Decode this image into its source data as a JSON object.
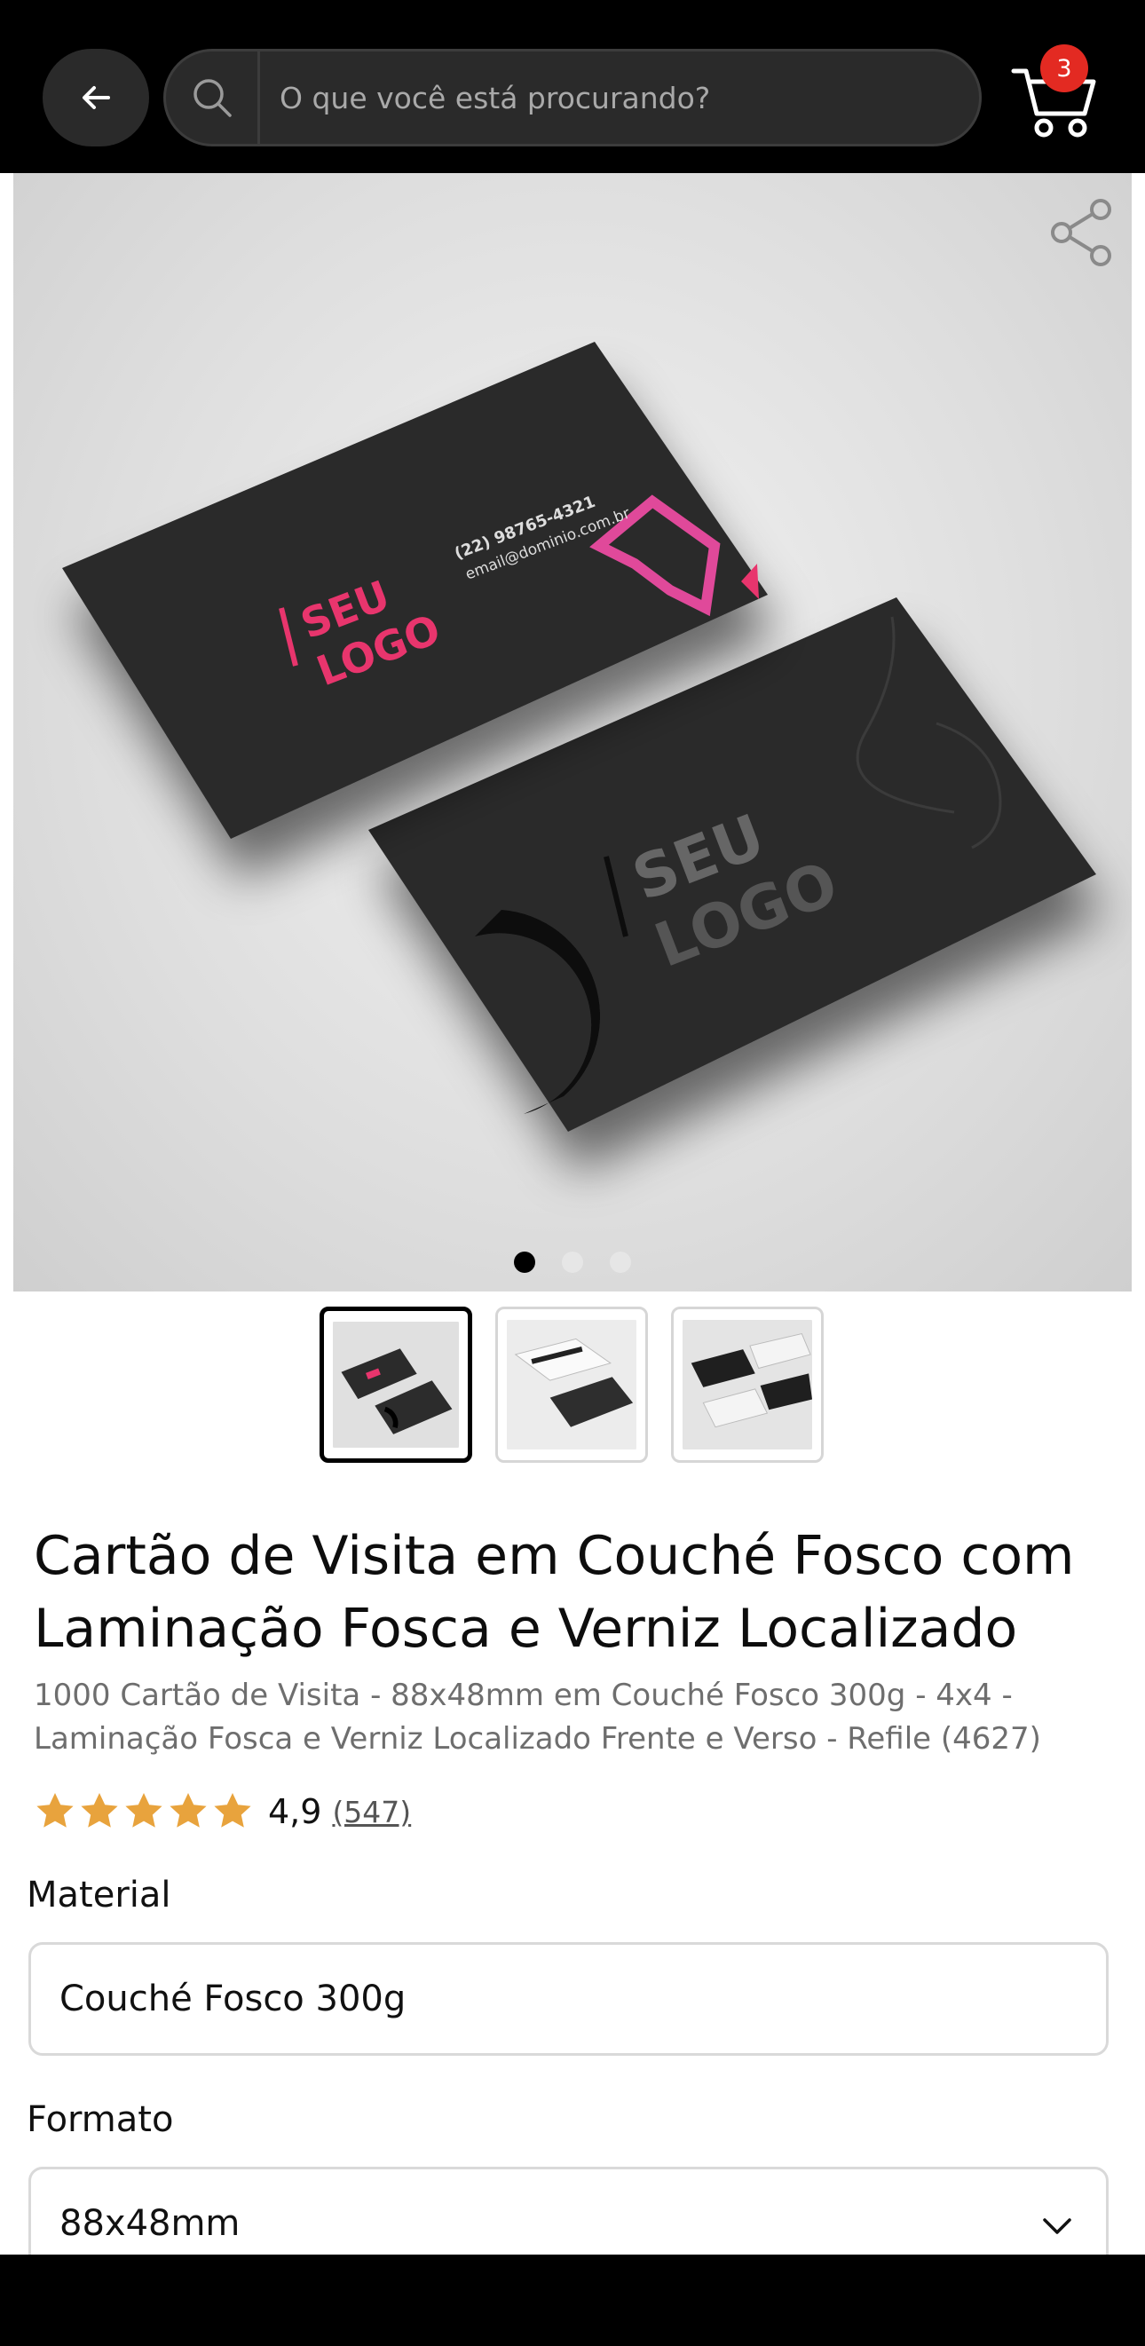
{
  "header": {
    "back_label": "back",
    "search_placeholder": "O que você está procurando?",
    "cart_count": "3"
  },
  "gallery": {
    "slide_count": 3,
    "active_slide": 1,
    "card_front": {
      "logo_line1": "SEU",
      "logo_line2": "LOGO",
      "phone": "(22) 98765-4321",
      "email": "email@dominio.com.br"
    },
    "card_back": {
      "logo_line1": "SEU",
      "logo_line2": "LOGO"
    }
  },
  "product": {
    "title": "Cartão de Visita em Couché Fosco com Laminação Fosca e Verniz Localizado",
    "subtitle": "1000 Cartão de Visita - 88x48mm em Couché Fosco 300g - 4x4 - Laminação Fosca e Verniz Localizado Frente e Verso - Refile (4627)",
    "rating_value": "4,9",
    "rating_count": "(547)",
    "stars": 5
  },
  "options": {
    "material_label": "Material",
    "material_value": "Couché Fosco 300g",
    "format_label": "Formato",
    "format_value": "88x48mm"
  },
  "colors": {
    "header_bg": "#000000",
    "badge": "#e32a22",
    "star": "#e8a33d",
    "accent_pink": "#e8356d"
  }
}
